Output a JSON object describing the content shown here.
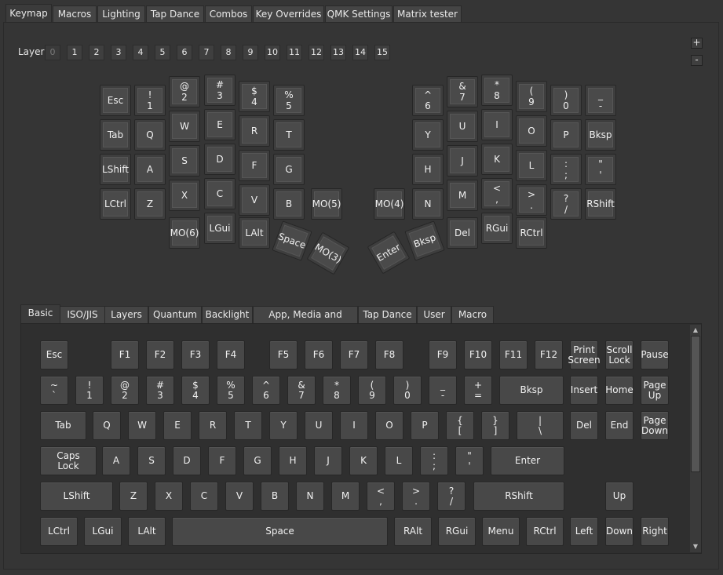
{
  "top_tabs": [
    "Keymap",
    "Macros",
    "Lighting",
    "Tap Dance",
    "Combos",
    "Key Overrides",
    "QMK Settings",
    "Matrix tester"
  ],
  "active_top_tab": "Keymap",
  "layer": {
    "label": "Layer",
    "buttons": [
      "0",
      "1",
      "2",
      "3",
      "4",
      "5",
      "6",
      "7",
      "8",
      "9",
      "10",
      "11",
      "12",
      "13",
      "14",
      "15"
    ],
    "active": "0",
    "plus_label": "+",
    "minus_label": "-"
  },
  "keymap_keys": [
    [
      "Esc"
    ],
    [
      "!",
      "1"
    ],
    [
      "@",
      "2"
    ],
    [
      "#",
      "3"
    ],
    [
      "$",
      "4"
    ],
    [
      "%",
      "5"
    ],
    [
      "Tab"
    ],
    [
      "Q"
    ],
    [
      "W"
    ],
    [
      "E"
    ],
    [
      "R"
    ],
    [
      "T"
    ],
    [
      "LShift"
    ],
    [
      "A"
    ],
    [
      "S"
    ],
    [
      "D"
    ],
    [
      "F"
    ],
    [
      "G"
    ],
    [
      "LCtrl"
    ],
    [
      "Z"
    ],
    [
      "X"
    ],
    [
      "C"
    ],
    [
      "V"
    ],
    [
      "B"
    ],
    [
      "MO(5)"
    ],
    [
      "MO(6)"
    ],
    [
      "LGui"
    ],
    [
      "LAlt"
    ],
    [
      "Space"
    ],
    [
      "MO(3)"
    ],
    [
      "^",
      "6"
    ],
    [
      "&",
      "7"
    ],
    [
      "*",
      "8"
    ],
    [
      "(",
      "9"
    ],
    [
      ")",
      "0"
    ],
    [
      "_",
      "-"
    ],
    [
      "Y"
    ],
    [
      "U"
    ],
    [
      "I"
    ],
    [
      "O"
    ],
    [
      "P"
    ],
    [
      "Bksp"
    ],
    [
      "H"
    ],
    [
      "J"
    ],
    [
      "K"
    ],
    [
      "L"
    ],
    [
      ":",
      ";"
    ],
    [
      "\"",
      "'"
    ],
    [
      "MO(4)"
    ],
    [
      "N"
    ],
    [
      "M"
    ],
    [
      "<",
      ","
    ],
    [
      ">",
      "."
    ],
    [
      "?",
      "/"
    ],
    [
      "RShift"
    ],
    [
      "Enter"
    ],
    [
      "Bksp"
    ],
    [
      "Del"
    ],
    [
      "RGui"
    ],
    [
      "RCtrl"
    ]
  ],
  "bottom_tabs": [
    "Basic",
    "ISO/JIS",
    "Layers",
    "Quantum",
    "Backlight",
    "App, Media and Mouse",
    "Tap Dance",
    "User",
    "Macro"
  ],
  "active_bottom_tab": "Basic",
  "basic_keys": [
    [
      "Esc"
    ],
    [
      "F1"
    ],
    [
      "F2"
    ],
    [
      "F3"
    ],
    [
      "F4"
    ],
    [
      "F5"
    ],
    [
      "F6"
    ],
    [
      "F7"
    ],
    [
      "F8"
    ],
    [
      "F9"
    ],
    [
      "F10"
    ],
    [
      "F11"
    ],
    [
      "F12"
    ],
    [
      "Print",
      "Screen"
    ],
    [
      "Scroll",
      "Lock"
    ],
    [
      "Pause"
    ],
    [
      "~",
      "`"
    ],
    [
      "!",
      "1"
    ],
    [
      "@",
      "2"
    ],
    [
      "#",
      "3"
    ],
    [
      "$",
      "4"
    ],
    [
      "%",
      "5"
    ],
    [
      "^",
      "6"
    ],
    [
      "&",
      "7"
    ],
    [
      "*",
      "8"
    ],
    [
      "(",
      "9"
    ],
    [
      ")",
      "0"
    ],
    [
      "_",
      "-"
    ],
    [
      "+",
      "="
    ],
    [
      "Bksp"
    ],
    [
      "Insert"
    ],
    [
      "Home"
    ],
    [
      "Page",
      "Up"
    ],
    [
      "Tab"
    ],
    [
      "Q"
    ],
    [
      "W"
    ],
    [
      "E"
    ],
    [
      "R"
    ],
    [
      "T"
    ],
    [
      "Y"
    ],
    [
      "U"
    ],
    [
      "I"
    ],
    [
      "O"
    ],
    [
      "P"
    ],
    [
      "{",
      "["
    ],
    [
      "}",
      "]"
    ],
    [
      "|",
      "\\"
    ],
    [
      "Del"
    ],
    [
      "End"
    ],
    [
      "Page",
      "Down"
    ],
    [
      "Caps",
      "Lock"
    ],
    [
      "A"
    ],
    [
      "S"
    ],
    [
      "D"
    ],
    [
      "F"
    ],
    [
      "G"
    ],
    [
      "H"
    ],
    [
      "J"
    ],
    [
      "K"
    ],
    [
      "L"
    ],
    [
      ":",
      ";"
    ],
    [
      "\"",
      "'"
    ],
    [
      "Enter"
    ],
    [
      "LShift"
    ],
    [
      "Z"
    ],
    [
      "X"
    ],
    [
      "C"
    ],
    [
      "V"
    ],
    [
      "B"
    ],
    [
      "N"
    ],
    [
      "M"
    ],
    [
      "<",
      ","
    ],
    [
      ">",
      "."
    ],
    [
      "?",
      "/"
    ],
    [
      "RShift"
    ],
    [
      "Up"
    ],
    [
      "LCtrl"
    ],
    [
      "LGui"
    ],
    [
      "LAlt"
    ],
    [
      "Space"
    ],
    [
      "RAlt"
    ],
    [
      "RGui"
    ],
    [
      "Menu"
    ],
    [
      "RCtrl"
    ],
    [
      "Left"
    ],
    [
      "Down"
    ],
    [
      "Right"
    ]
  ],
  "icons": {
    "scroll_up": "triangle-up-icon",
    "scroll_down": "triangle-down-icon"
  }
}
